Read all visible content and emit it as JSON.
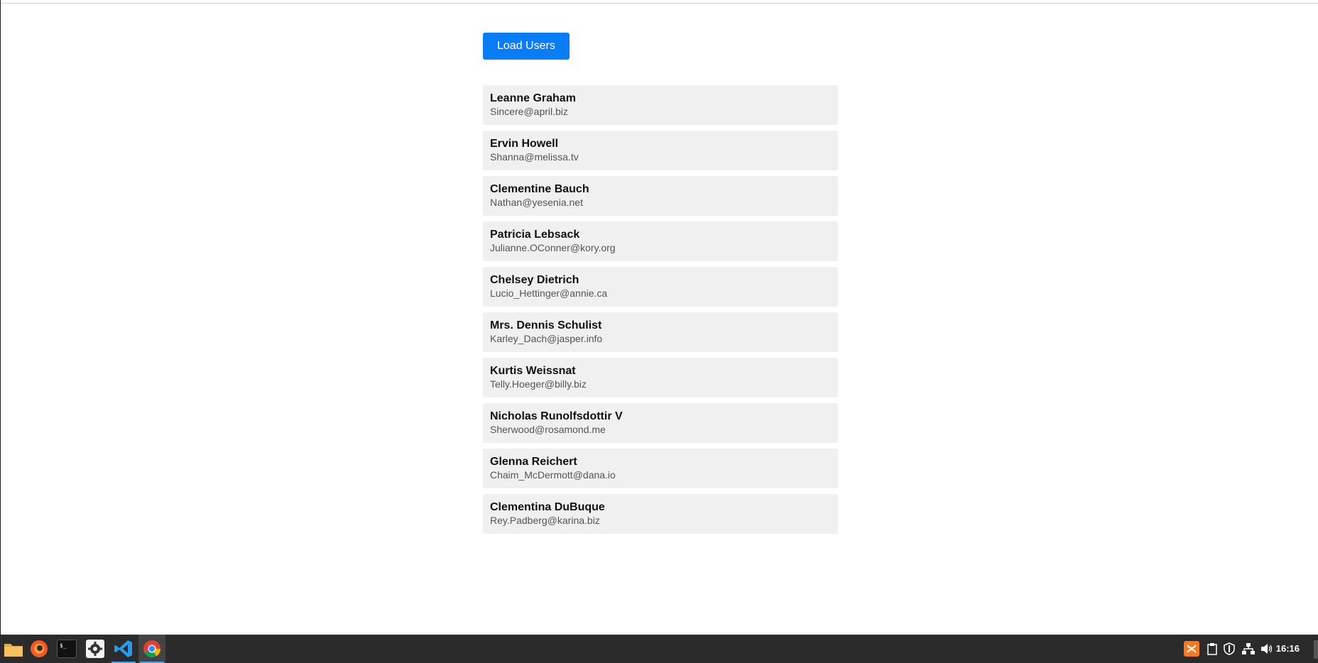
{
  "page": {
    "load_button_label": "Load Users"
  },
  "users": [
    {
      "name": "Leanne Graham",
      "email": "Sincere@april.biz"
    },
    {
      "name": "Ervin Howell",
      "email": "Shanna@melissa.tv"
    },
    {
      "name": "Clementine Bauch",
      "email": "Nathan@yesenia.net"
    },
    {
      "name": "Patricia Lebsack",
      "email": "Julianne.OConner@kory.org"
    },
    {
      "name": "Chelsey Dietrich",
      "email": "Lucio_Hettinger@annie.ca"
    },
    {
      "name": "Mrs. Dennis Schulist",
      "email": "Karley_Dach@jasper.info"
    },
    {
      "name": "Kurtis Weissnat",
      "email": "Telly.Hoeger@billy.biz"
    },
    {
      "name": "Nicholas Runolfsdottir V",
      "email": "Sherwood@rosamond.me"
    },
    {
      "name": "Glenna Reichert",
      "email": "Chaim_McDermott@dana.io"
    },
    {
      "name": "Clementina DuBuque",
      "email": "Rey.Padberg@karina.biz"
    }
  ],
  "taskbar": {
    "apps": [
      {
        "name": "file-manager-icon"
      },
      {
        "name": "firefox-icon"
      },
      {
        "name": "terminal-icon"
      },
      {
        "name": "settings-icon"
      },
      {
        "name": "vscode-icon"
      },
      {
        "name": "chrome-icon"
      }
    ],
    "tray": [
      "xampp-icon",
      "clipboard-icon",
      "shield-icon",
      "network-icon",
      "volume-icon"
    ],
    "clock": "16:16"
  },
  "colors": {
    "button": "#0a7cf5",
    "card": "#f0f0f0",
    "taskbar": "#2b2b2b"
  }
}
